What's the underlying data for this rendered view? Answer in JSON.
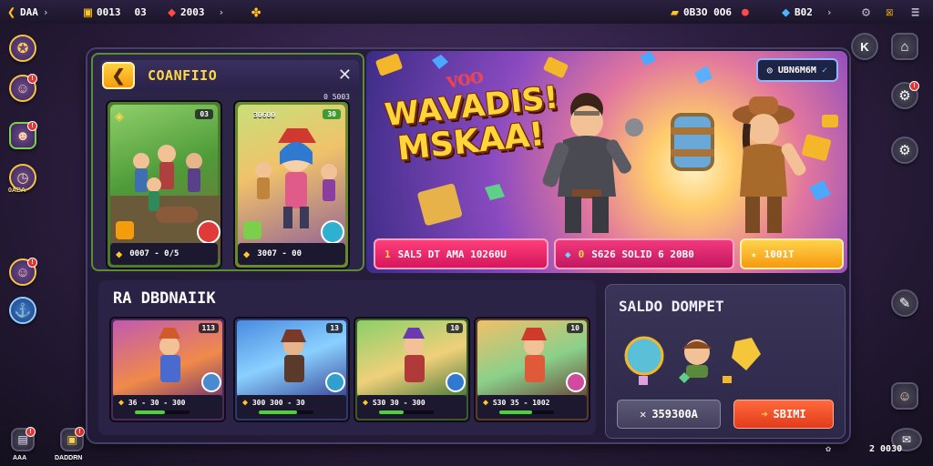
{
  "topbar": {
    "player_label": "DAA",
    "coin_value": "0013",
    "coin_extra": "03",
    "gem_value": "2003",
    "gold_value": "0B3O 0O6",
    "gem2_value": "B02"
  },
  "left_panel": {
    "title": "COANFIIO",
    "subtitle": "0 5003",
    "cards": [
      {
        "level": "03",
        "footer": "0007 - 0/5"
      },
      {
        "tag": "30600",
        "level": "30",
        "footer": "3007 - 00"
      }
    ]
  },
  "banner": {
    "kicker": "VOO",
    "title_line1": "WAVADIS!",
    "title_line2": "MSKAA!",
    "pill_label": "UBN6M6M",
    "offers": [
      {
        "num": "1",
        "text": "SAL5 DT AMA 10260U"
      },
      {
        "num": "0",
        "text": "S626 SOLID 6 20B0"
      },
      {
        "text": "1001T"
      }
    ]
  },
  "section": {
    "title": "RA DBDNAIIK",
    "cards": [
      {
        "level": "113",
        "footer": "36 - 30 - 300",
        "fill": 0.55
      },
      {
        "level": "13",
        "footer": "300 300 - 30",
        "fill": 0.7
      },
      {
        "level": "10",
        "footer": "S30 30 - 300",
        "fill": 0.45
      },
      {
        "level": "10",
        "footer": "S30 35 - 1002",
        "fill": 0.6
      }
    ]
  },
  "side_panel": {
    "title": "SALDO DOMPET",
    "btn_secondary": "359300A",
    "btn_primary": "SBIMI"
  },
  "left_rail": {
    "badge_label": "0ABA"
  },
  "bottom_left": {
    "label1": "AAA",
    "label2": "DADDRN"
  },
  "bottom_right": {
    "label": "2 0030"
  }
}
